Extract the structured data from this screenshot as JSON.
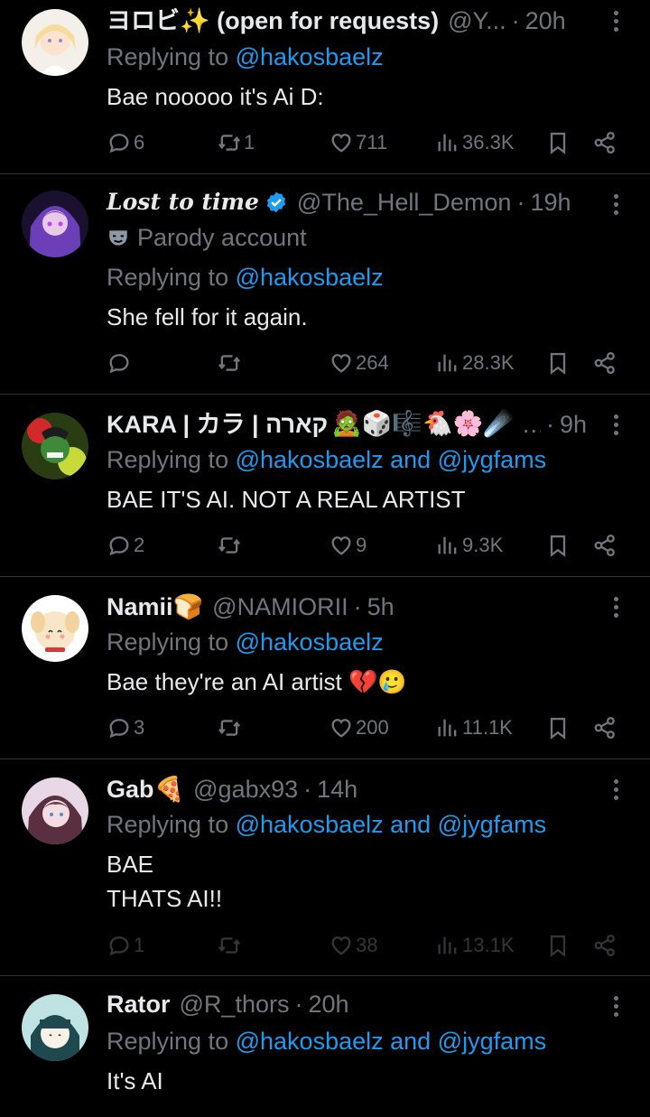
{
  "colors": {
    "background": "#000000",
    "text": "#e7e9ea",
    "muted": "#71767b",
    "link": "#1d9bf0",
    "divider": "#2f3336"
  },
  "icons": {
    "reply": "reply-icon",
    "retweet": "retweet-icon",
    "like": "heart-icon",
    "views": "views-icon",
    "bookmark": "bookmark-icon",
    "share": "share-icon",
    "more": "more-icon",
    "verified": "verified-badge-icon",
    "parody": "parody-mask-icon"
  },
  "tweets": [
    {
      "name": "ヨロビ✨ (open for requests)",
      "handle": "@Y...",
      "dot": "·",
      "time": "20h",
      "reply_prefix": "Replying to",
      "mentions": "@hakosbaelz",
      "text": "Bae nooooo it's Ai D:",
      "stats": {
        "replies": "6",
        "retweets": "1",
        "likes": "711",
        "views": "36.3K"
      }
    },
    {
      "name": "Lost to time",
      "handle": "@The_Hell_Demon",
      "dot": "·",
      "time": "19h",
      "label": "Parody account",
      "reply_prefix": "Replying to",
      "mentions": "@hakosbaelz",
      "text": "She fell for it again.",
      "stats": {
        "replies": "",
        "retweets": "",
        "likes": "264",
        "views": "28.3K"
      }
    },
    {
      "name": "KARA | カラ | קארה",
      "emojis": "🧟🎲🎼🐔🌸☄️",
      "handle": "...",
      "dot": "·",
      "time": "9h",
      "reply_prefix": "Replying to",
      "mentions": "@hakosbaelz and @jygfams",
      "text": "BAE IT'S AI. NOT A REAL ARTIST",
      "stats": {
        "replies": "2",
        "retweets": "",
        "likes": "9",
        "views": "9.3K"
      }
    },
    {
      "name": "Namii🍞",
      "handle": "@NAMIORII",
      "dot": "·",
      "time": "5h",
      "reply_prefix": "Replying to",
      "mentions": "@hakosbaelz",
      "text": "Bae they're an AI artist 💔🥲",
      "stats": {
        "replies": "3",
        "retweets": "",
        "likes": "200",
        "views": "11.1K"
      }
    },
    {
      "name": "Gab🍕",
      "handle": "@gabx93",
      "dot": "·",
      "time": "14h",
      "reply_prefix": "Replying to",
      "mentions": "@hakosbaelz and @jygfams",
      "text": "BAE\nTHATS AI!!",
      "stats": {
        "replies": "1",
        "retweets": "",
        "likes": "38",
        "views": "13.1K"
      }
    },
    {
      "name": "Rator",
      "handle": "@R_thors",
      "dot": "·",
      "time": "20h",
      "reply_prefix": "Replying to",
      "mentions": "@hakosbaelz and @jygfams",
      "text": "It's AI"
    }
  ]
}
